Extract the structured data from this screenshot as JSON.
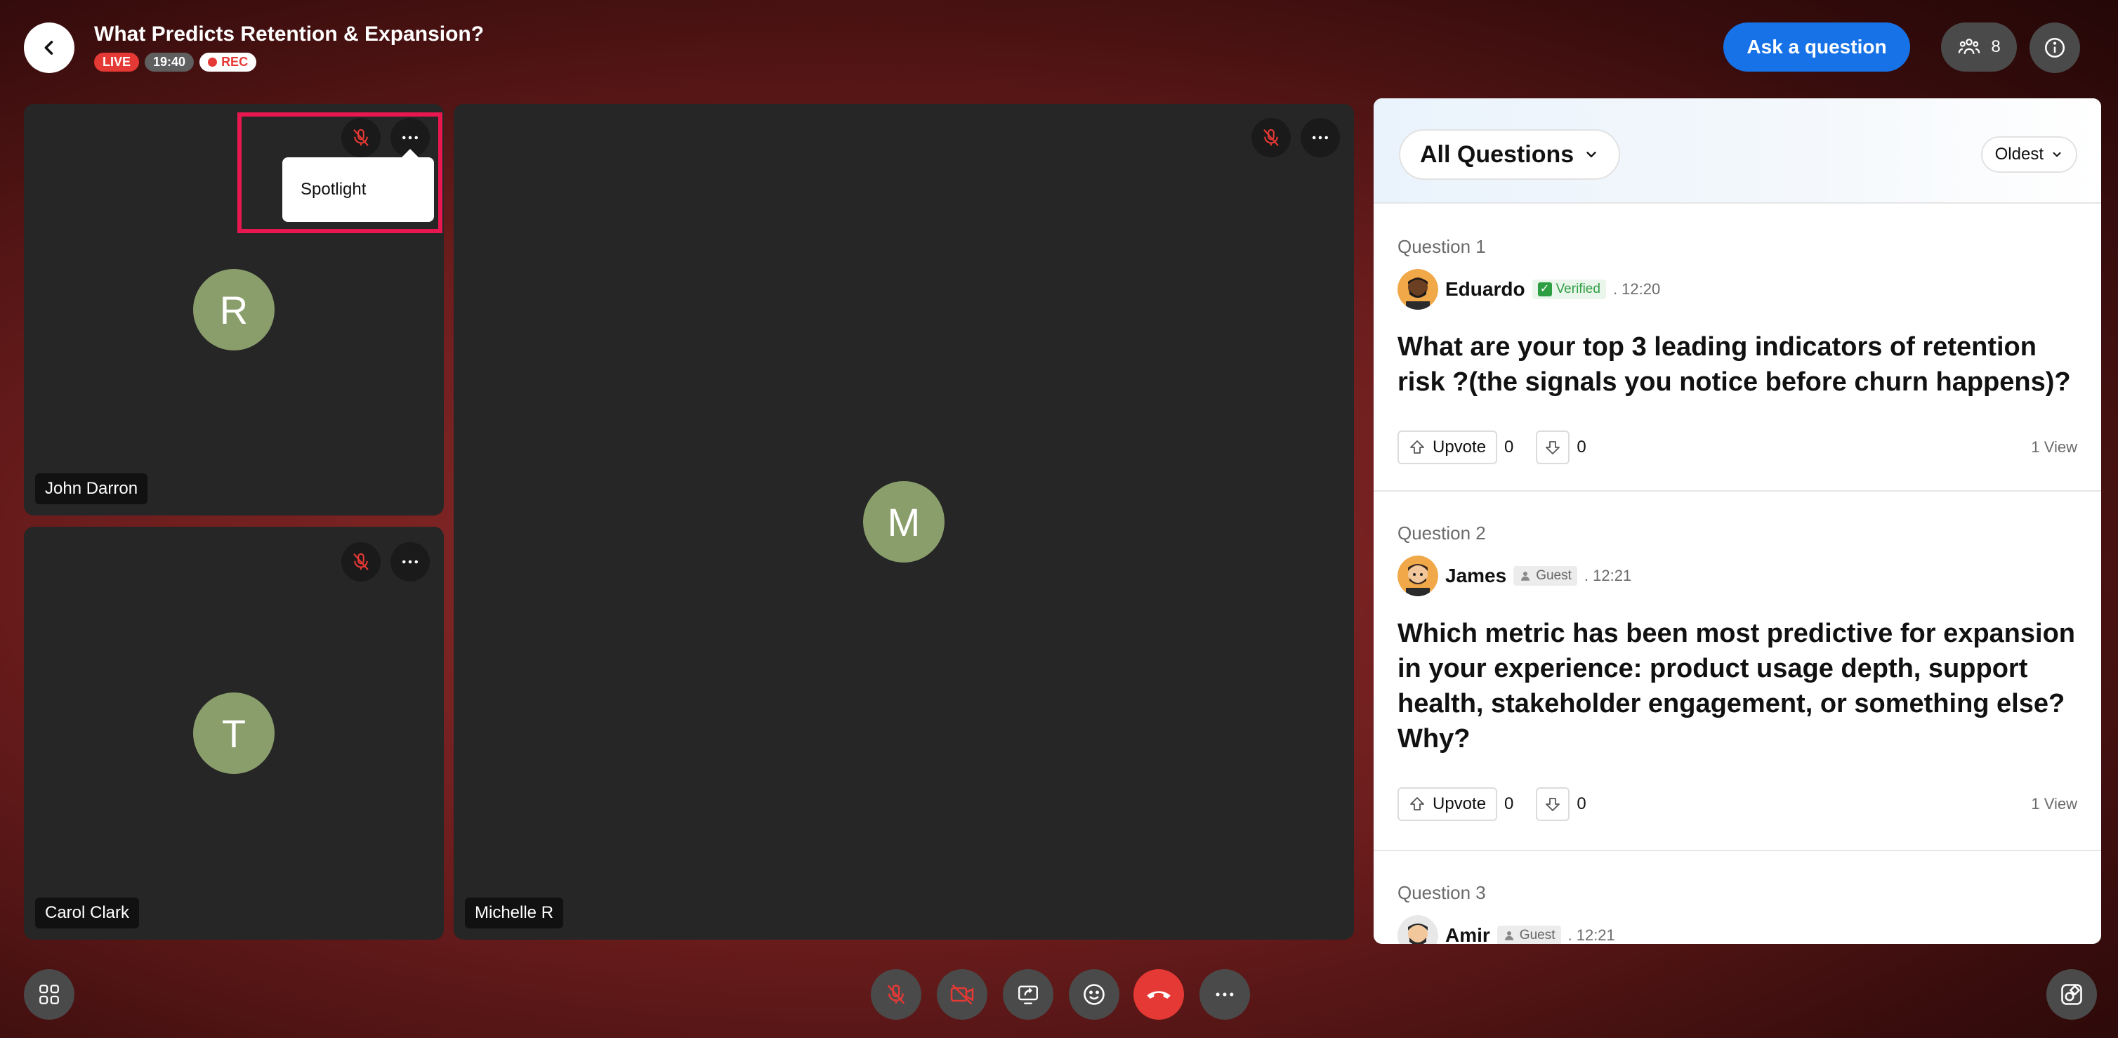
{
  "header": {
    "title": "What Predicts Retention & Expansion?",
    "live_badge": "LIVE",
    "timer": "19:40",
    "rec_badge": "REC",
    "ask_button": "Ask a question",
    "participant_count": "8"
  },
  "tiles": [
    {
      "initial": "R",
      "name": "John Darron"
    },
    {
      "initial": "T",
      "name": "Carol Clark"
    },
    {
      "initial": "M",
      "name": "Michelle R"
    }
  ],
  "tile_menu": {
    "spotlight_label": "Spotlight"
  },
  "questions_panel": {
    "filter_label": "All Questions",
    "sort_label": "Oldest",
    "questions": [
      {
        "number_label": "Question 1",
        "author": "Eduardo",
        "tag": "Verified",
        "time": ". 12:20",
        "text": "What are your top 3 leading indicators of retention risk ?(the signals you notice before churn happens)?",
        "upvote_label": "Upvote",
        "upvotes": "0",
        "downvotes": "0",
        "views": "1 View"
      },
      {
        "number_label": "Question 2",
        "author": "James",
        "tag": "Guest",
        "time": ". 12:21",
        "text": "Which metric has been most predictive for expansion in your experience: product usage depth, support health, stakeholder engagement, or something else? Why?",
        "upvote_label": "Upvote",
        "upvotes": "0",
        "downvotes": "0",
        "views": "1 View"
      },
      {
        "number_label": "Question 3",
        "author": "Amir",
        "tag": "Guest",
        "time": ". 12:21"
      }
    ]
  },
  "colors": {
    "accent_blue": "#1672e6",
    "live_red": "#e53935",
    "highlight_pink": "#e8174f",
    "avatar_green": "#8a9e6c",
    "verified_green": "#2e9e43"
  }
}
